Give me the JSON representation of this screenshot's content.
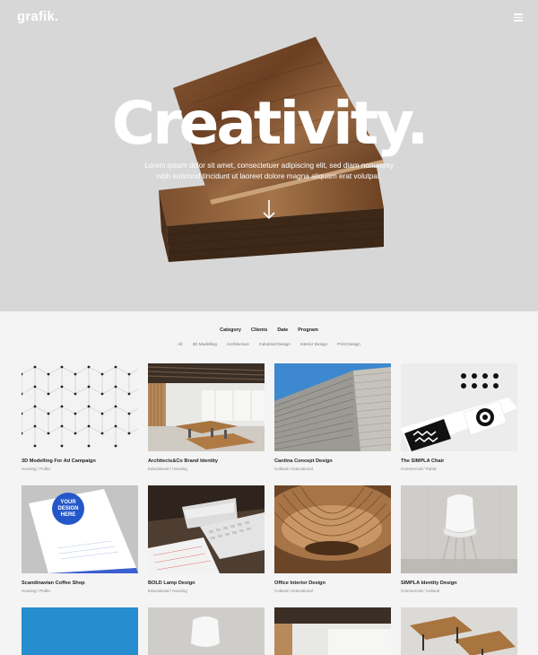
{
  "brand": {
    "logo_text": "grafik."
  },
  "header": {
    "menu_icon": "hamburger-icon"
  },
  "hero": {
    "headline": "Creativity.",
    "lede": "Lorem ipsum dolor sit amet, consectetuer adipiscing elit, sed diam nonummy nibh euismod tincidunt ut laoreet dolore magna aliquam erat volutpat.",
    "scroll_icon": "arrow-down-icon",
    "bg_color": "#d7d7d7"
  },
  "filters": {
    "categories": [
      "Category",
      "Clients",
      "Date",
      "Program"
    ],
    "tags": [
      "All",
      "3D Modelling",
      "Architecture",
      "Industrial Design",
      "Interior Design",
      "Print Design"
    ]
  },
  "projects": [
    {
      "title": "3D Modelling For Ad Campaign",
      "meta": "Housing / Public"
    },
    {
      "title": "Architects&Co Brand Identity",
      "meta": "Educational / Housing"
    },
    {
      "title": "Cantina Concept Design",
      "meta": "Cultural / Educational"
    },
    {
      "title": "The SIMPLA Chair",
      "meta": "Commercial / Public"
    },
    {
      "title": "Scandinavian Coffee Shop",
      "meta": "Housing / Public"
    },
    {
      "title": "BOLD Lamp Design",
      "meta": "Educational / Housing"
    },
    {
      "title": "Office Interior Design",
      "meta": "Cultural / Educational"
    },
    {
      "title": "SIMPLA Identity Design",
      "meta": "Commercial / Cultural"
    }
  ],
  "mockup_text": {
    "line1": "YOUR",
    "line2": "DESIGN",
    "line3": "HERE"
  }
}
